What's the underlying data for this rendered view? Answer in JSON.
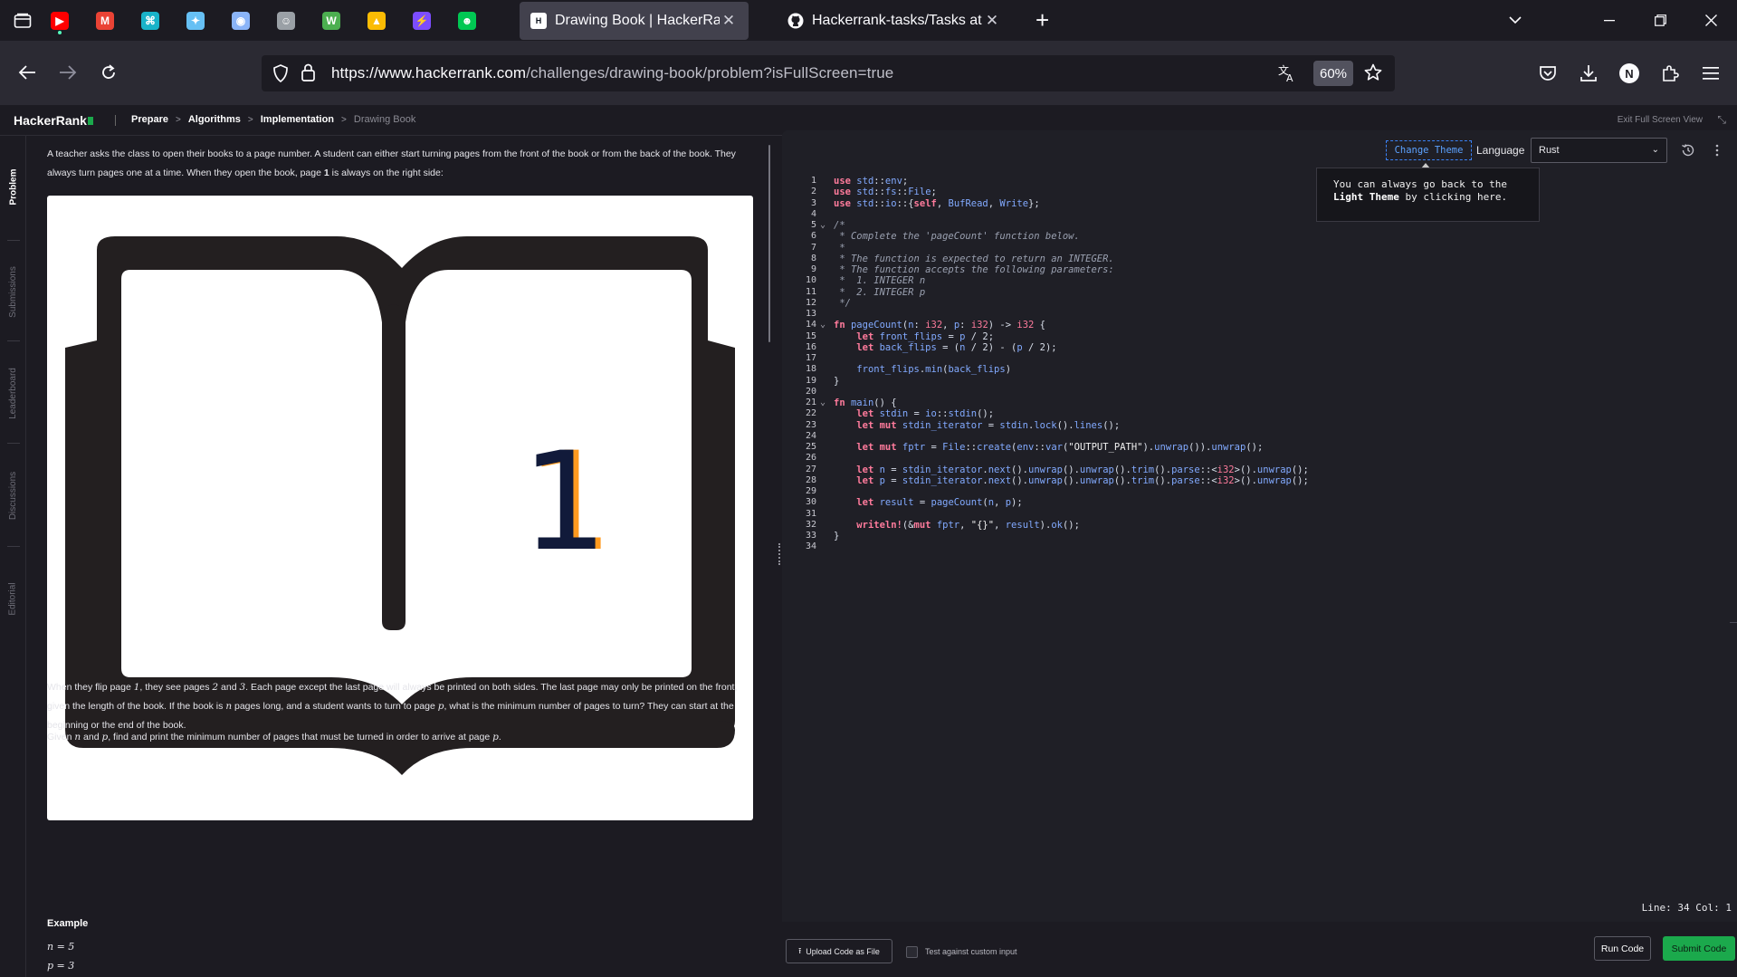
{
  "browser": {
    "pinned_tabs": [
      {
        "icon": "youtube-icon",
        "color": "#ff0000",
        "glyph": "▶",
        "playing": true
      },
      {
        "icon": "gmail-icon",
        "color": "#ea4335",
        "glyph": "M"
      },
      {
        "icon": "app-icon",
        "color": "#19b3c9",
        "glyph": "⌘"
      },
      {
        "icon": "steam-icon",
        "color": "#66c0f4",
        "glyph": "✦"
      },
      {
        "icon": "chrome-store-icon",
        "color": "#8ab4f8",
        "glyph": "◉"
      },
      {
        "icon": "contacts-icon",
        "color": "#9aa0a6",
        "glyph": "☺"
      },
      {
        "icon": "w-icon",
        "color": "#4caf50",
        "glyph": "W"
      },
      {
        "icon": "drive-icon",
        "color": "#fbbc04",
        "glyph": "▲"
      },
      {
        "icon": "bolt-icon",
        "color": "#7c4dff",
        "glyph": "⚡"
      },
      {
        "icon": "monster-icon",
        "color": "#00c853",
        "glyph": "☻"
      }
    ],
    "active_tab": {
      "title": "Drawing Book | HackerRank",
      "favicon": "H"
    },
    "inactive_tab": {
      "title": "Hackerrank-tasks/Tasks at main"
    },
    "url_host": "https://www.hackerrank.com",
    "url_path": "/challenges/drawing-book/problem?isFullScreen=true",
    "zoom": "60%",
    "profile_initial": "N"
  },
  "hr": {
    "logo": "HackerRank",
    "breadcrumbs": [
      "Prepare",
      "Algorithms",
      "Implementation",
      "Drawing Book"
    ],
    "exit_fullscreen": "Exit Full Screen View",
    "vtabs": [
      "Problem",
      "Submissions",
      "Leaderboard",
      "Discussions",
      "Editorial"
    ]
  },
  "problem": {
    "intro_line1": "A teacher asks the class to open their books to a page number. A student can either start turning pages from the front of the book or from the back of the book. They",
    "intro_line2a": "always turn pages one at a time. When they open the book, page ",
    "intro_page": "1",
    "intro_line2b": " is always on the right side:",
    "image_page_number": "1",
    "flip_line1a": "When they flip page ",
    "flip_p1": "1",
    "flip_line1b": ", they see pages ",
    "flip_p2": "2",
    "flip_and": " and ",
    "flip_p3": "3",
    "flip_line1c": ". Each page except the last page will always be printed on both sides. The last page may only be printed on the front,",
    "flip_line2a": "given the length of the book. If the book is ",
    "flip_n": "n",
    "flip_line2b": " pages long, and a student wants to turn to page ",
    "flip_p": "p",
    "flip_line2c": ", what is the minimum number of pages to turn? They can start at the",
    "flip_line3": "beginning or the end of the book.",
    "given_a": "Given ",
    "given_n": "n",
    "given_and": " and ",
    "given_p": "p",
    "given_b": ", find and print the minimum number of pages that must be turned in order to arrive at page ",
    "given_p2": "p",
    "given_c": ".",
    "example_heading": "Example",
    "eq1": "n = 5",
    "eq2": "p = 3"
  },
  "editor": {
    "change_theme": "Change Theme",
    "language_label": "Language",
    "language_value": "Rust",
    "tooltip_line1": "You can always go back to the",
    "tooltip_bold": "Light Theme",
    "tooltip_line2": " by clicking here.",
    "status": "Line: 34 Col: 1",
    "code_lines": [
      "1",
      "2",
      "3",
      "4",
      "5",
      "6",
      "7",
      "8",
      "9",
      "10",
      "11",
      "12",
      "13",
      "14",
      "15",
      "16",
      "17",
      "18",
      "19",
      "20",
      "21",
      "22",
      "23",
      "24",
      "25",
      "26",
      "27",
      "28",
      "29",
      "30",
      "31",
      "32",
      "33",
      "34"
    ]
  },
  "actions": {
    "upload": "Upload Code as File",
    "custom_input": "Test against custom input",
    "run": "Run Code",
    "submit": "Submit Code"
  },
  "colors": {
    "accent_green": "#1ba94c",
    "theme_link": "#5ca2ff",
    "keyword": "#ff7b9c",
    "identifier": "#82aaff"
  }
}
